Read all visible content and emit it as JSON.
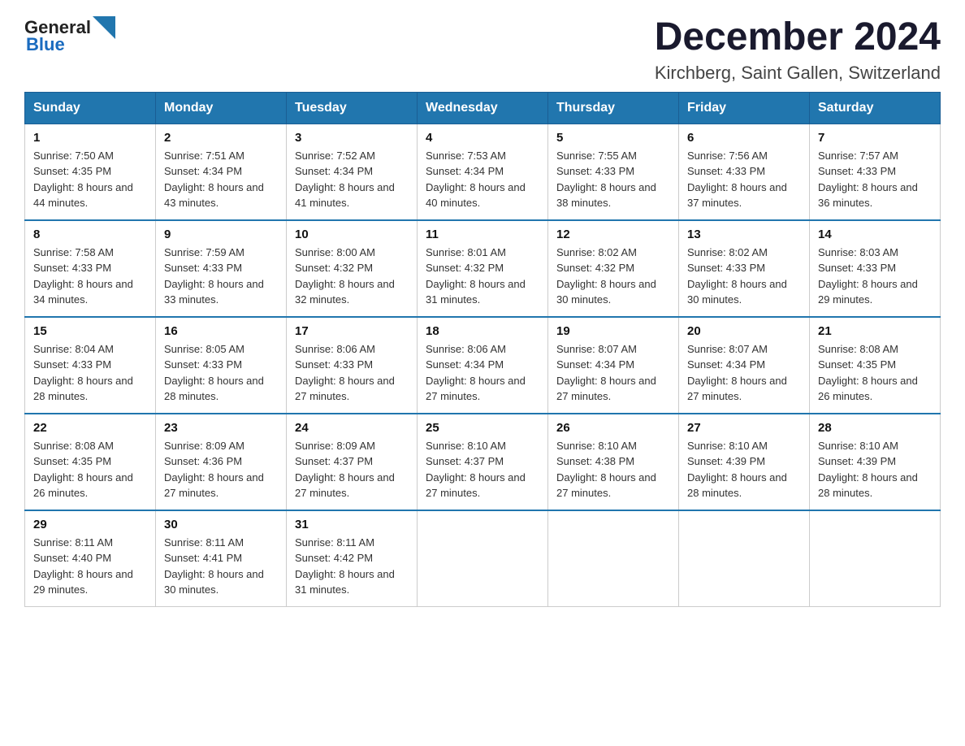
{
  "header": {
    "logo_text_general": "General",
    "logo_text_blue": "Blue",
    "title": "December 2024",
    "subtitle": "Kirchberg, Saint Gallen, Switzerland"
  },
  "weekdays": [
    "Sunday",
    "Monday",
    "Tuesday",
    "Wednesday",
    "Thursday",
    "Friday",
    "Saturday"
  ],
  "weeks": [
    [
      {
        "day": "1",
        "sunrise": "7:50 AM",
        "sunset": "4:35 PM",
        "daylight": "8 hours and 44 minutes."
      },
      {
        "day": "2",
        "sunrise": "7:51 AM",
        "sunset": "4:34 PM",
        "daylight": "8 hours and 43 minutes."
      },
      {
        "day": "3",
        "sunrise": "7:52 AM",
        "sunset": "4:34 PM",
        "daylight": "8 hours and 41 minutes."
      },
      {
        "day": "4",
        "sunrise": "7:53 AM",
        "sunset": "4:34 PM",
        "daylight": "8 hours and 40 minutes."
      },
      {
        "day": "5",
        "sunrise": "7:55 AM",
        "sunset": "4:33 PM",
        "daylight": "8 hours and 38 minutes."
      },
      {
        "day": "6",
        "sunrise": "7:56 AM",
        "sunset": "4:33 PM",
        "daylight": "8 hours and 37 minutes."
      },
      {
        "day": "7",
        "sunrise": "7:57 AM",
        "sunset": "4:33 PM",
        "daylight": "8 hours and 36 minutes."
      }
    ],
    [
      {
        "day": "8",
        "sunrise": "7:58 AM",
        "sunset": "4:33 PM",
        "daylight": "8 hours and 34 minutes."
      },
      {
        "day": "9",
        "sunrise": "7:59 AM",
        "sunset": "4:33 PM",
        "daylight": "8 hours and 33 minutes."
      },
      {
        "day": "10",
        "sunrise": "8:00 AM",
        "sunset": "4:32 PM",
        "daylight": "8 hours and 32 minutes."
      },
      {
        "day": "11",
        "sunrise": "8:01 AM",
        "sunset": "4:32 PM",
        "daylight": "8 hours and 31 minutes."
      },
      {
        "day": "12",
        "sunrise": "8:02 AM",
        "sunset": "4:32 PM",
        "daylight": "8 hours and 30 minutes."
      },
      {
        "day": "13",
        "sunrise": "8:02 AM",
        "sunset": "4:33 PM",
        "daylight": "8 hours and 30 minutes."
      },
      {
        "day": "14",
        "sunrise": "8:03 AM",
        "sunset": "4:33 PM",
        "daylight": "8 hours and 29 minutes."
      }
    ],
    [
      {
        "day": "15",
        "sunrise": "8:04 AM",
        "sunset": "4:33 PM",
        "daylight": "8 hours and 28 minutes."
      },
      {
        "day": "16",
        "sunrise": "8:05 AM",
        "sunset": "4:33 PM",
        "daylight": "8 hours and 28 minutes."
      },
      {
        "day": "17",
        "sunrise": "8:06 AM",
        "sunset": "4:33 PM",
        "daylight": "8 hours and 27 minutes."
      },
      {
        "day": "18",
        "sunrise": "8:06 AM",
        "sunset": "4:34 PM",
        "daylight": "8 hours and 27 minutes."
      },
      {
        "day": "19",
        "sunrise": "8:07 AM",
        "sunset": "4:34 PM",
        "daylight": "8 hours and 27 minutes."
      },
      {
        "day": "20",
        "sunrise": "8:07 AM",
        "sunset": "4:34 PM",
        "daylight": "8 hours and 27 minutes."
      },
      {
        "day": "21",
        "sunrise": "8:08 AM",
        "sunset": "4:35 PM",
        "daylight": "8 hours and 26 minutes."
      }
    ],
    [
      {
        "day": "22",
        "sunrise": "8:08 AM",
        "sunset": "4:35 PM",
        "daylight": "8 hours and 26 minutes."
      },
      {
        "day": "23",
        "sunrise": "8:09 AM",
        "sunset": "4:36 PM",
        "daylight": "8 hours and 27 minutes."
      },
      {
        "day": "24",
        "sunrise": "8:09 AM",
        "sunset": "4:37 PM",
        "daylight": "8 hours and 27 minutes."
      },
      {
        "day": "25",
        "sunrise": "8:10 AM",
        "sunset": "4:37 PM",
        "daylight": "8 hours and 27 minutes."
      },
      {
        "day": "26",
        "sunrise": "8:10 AM",
        "sunset": "4:38 PM",
        "daylight": "8 hours and 27 minutes."
      },
      {
        "day": "27",
        "sunrise": "8:10 AM",
        "sunset": "4:39 PM",
        "daylight": "8 hours and 28 minutes."
      },
      {
        "day": "28",
        "sunrise": "8:10 AM",
        "sunset": "4:39 PM",
        "daylight": "8 hours and 28 minutes."
      }
    ],
    [
      {
        "day": "29",
        "sunrise": "8:11 AM",
        "sunset": "4:40 PM",
        "daylight": "8 hours and 29 minutes."
      },
      {
        "day": "30",
        "sunrise": "8:11 AM",
        "sunset": "4:41 PM",
        "daylight": "8 hours and 30 minutes."
      },
      {
        "day": "31",
        "sunrise": "8:11 AM",
        "sunset": "4:42 PM",
        "daylight": "8 hours and 31 minutes."
      },
      null,
      null,
      null,
      null
    ]
  ],
  "labels": {
    "sunrise": "Sunrise:",
    "sunset": "Sunset:",
    "daylight": "Daylight:"
  }
}
